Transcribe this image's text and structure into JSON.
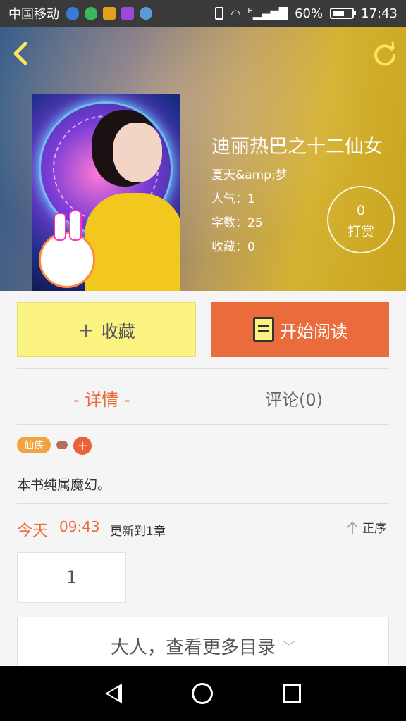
{
  "status_bar": {
    "carrier": "中国移动",
    "signal": "H",
    "battery": "60%",
    "time": "17:43"
  },
  "header": {
    "back_icon": "chevron-left-icon",
    "refresh_icon": "refresh-icon"
  },
  "book": {
    "title": "迪丽热巴之十二仙女",
    "author": "夏天&amp;梦",
    "popularity": "人气：1",
    "word_count": "字数：25",
    "favorites": "收藏：0",
    "tip_count": "0",
    "tip_label": "打赏"
  },
  "actions": {
    "fav_icon": "+",
    "fav_label": "收藏",
    "read_label": "开始阅读"
  },
  "tabs": {
    "detail": "-  详情  -",
    "comments": "评论(0)"
  },
  "tags": {
    "genre": "仙侠",
    "add": "+"
  },
  "description": "本书纯属魔幻。",
  "update": {
    "day": "今天",
    "time": "09:43",
    "text": "更新到1章",
    "order_label": "正序"
  },
  "chapters": [
    "1"
  ],
  "more_label": "大人，查看更多目录",
  "colors": {
    "accent": "#ea6b3b",
    "fav_bg": "#fbf382",
    "tag": "#f2a23e"
  }
}
